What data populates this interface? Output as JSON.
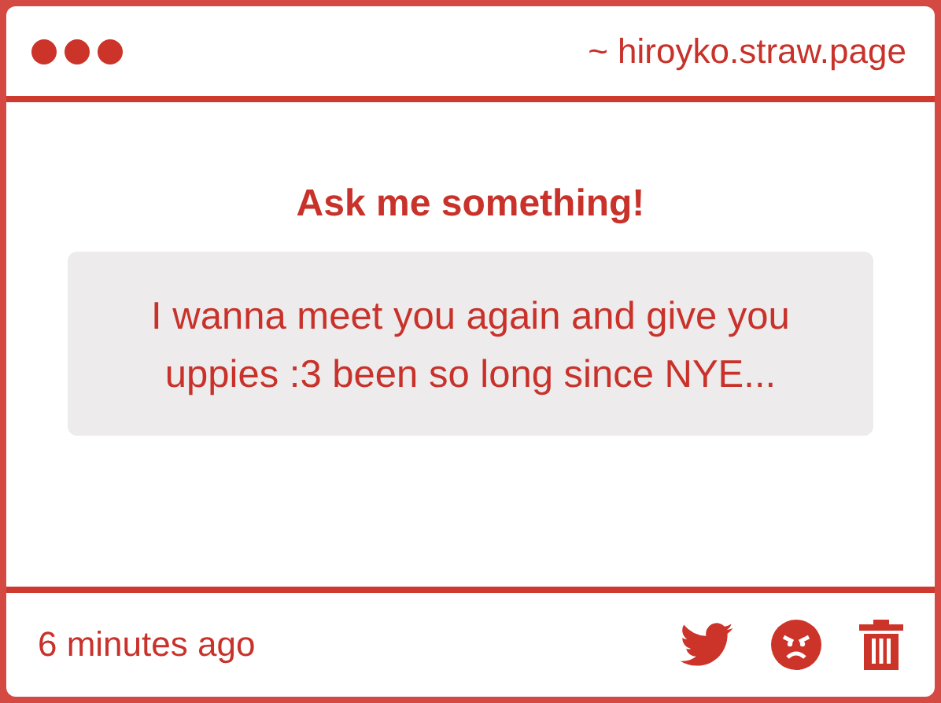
{
  "window": {
    "site": "~ hiroyko.straw.page"
  },
  "heading": "Ask me something!",
  "question": "I wanna meet you again and give you uppies :3 been so long since NYE...",
  "footer": {
    "time": "6 minutes ago"
  }
}
